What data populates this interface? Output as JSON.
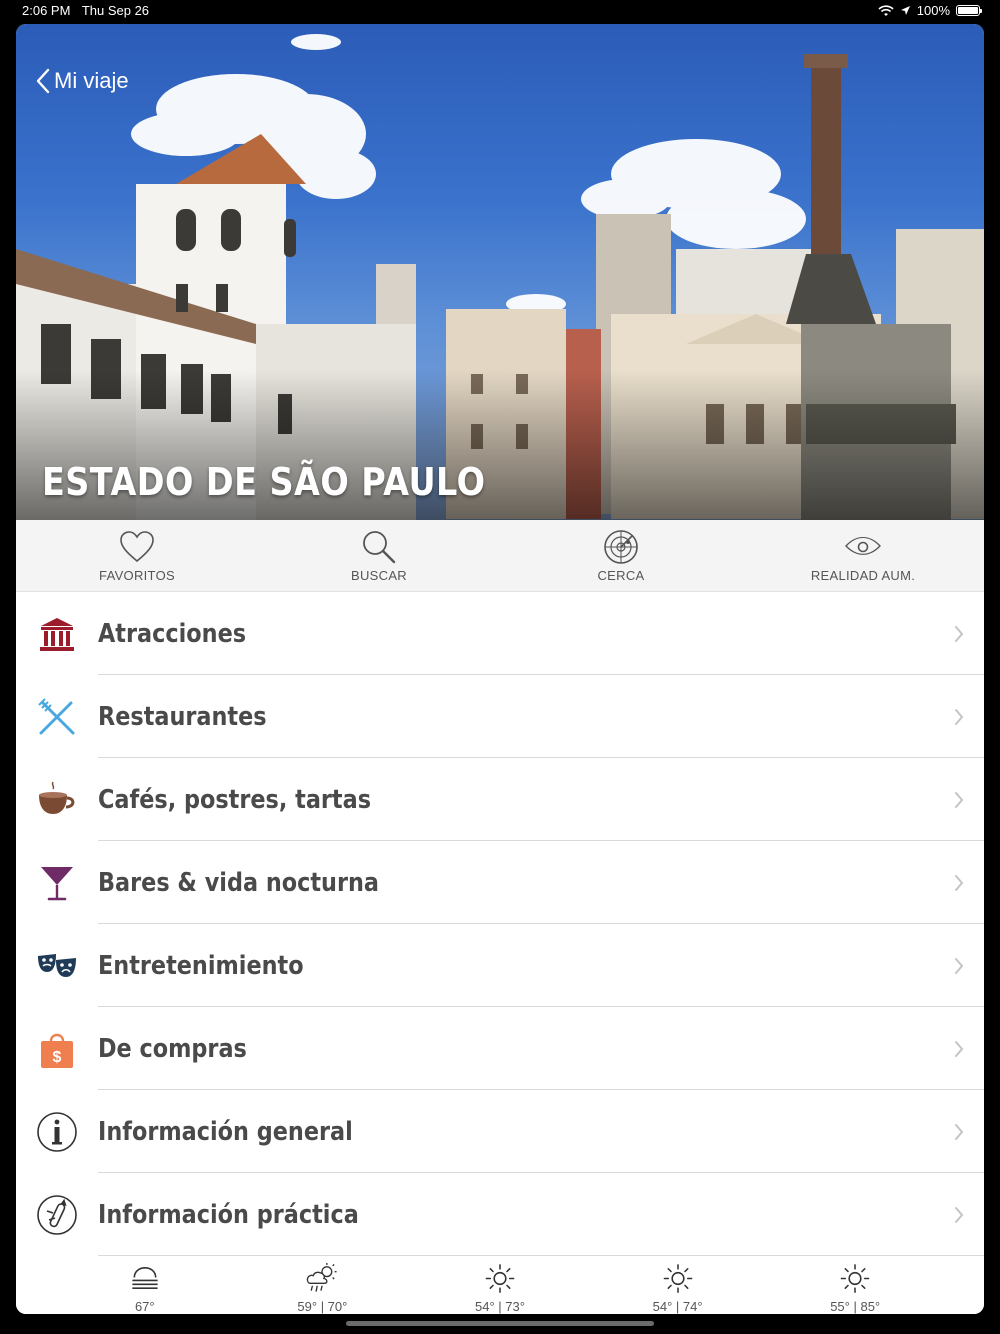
{
  "status_bar": {
    "time": "2:06 PM",
    "date": "Thu Sep 26",
    "battery": "100%",
    "battery_level": 1.0
  },
  "header": {
    "back_label": "Mi viaje",
    "title": "ESTADO DE SÃO PAULO"
  },
  "toolbar": [
    {
      "label": "FAVORITOS",
      "icon": "heart-icon"
    },
    {
      "label": "BUSCAR",
      "icon": "search-icon"
    },
    {
      "label": "CERCA",
      "icon": "radar-icon"
    },
    {
      "label": "REALIDAD AUM.",
      "icon": "eye-icon"
    }
  ],
  "menu": [
    {
      "label": "Atracciones",
      "icon": "museum-icon",
      "color": "#9b1c2a"
    },
    {
      "label": "Restaurantes",
      "icon": "fork-knife-icon",
      "color": "#4aa8e0"
    },
    {
      "label": "Cafés, postres, tartas",
      "icon": "coffee-cup-icon",
      "color": "#7b4a32"
    },
    {
      "label": "Bares & vida nocturna",
      "icon": "cocktail-icon",
      "color": "#6e2b66"
    },
    {
      "label": "Entretenimiento",
      "icon": "theater-masks-icon",
      "color": "#1f3b57"
    },
    {
      "label": "De compras",
      "icon": "shopping-bag-icon",
      "color": "#ef7f4f"
    },
    {
      "label": "Información general",
      "icon": "info-icon",
      "color": "#333333"
    },
    {
      "label": "Información práctica",
      "icon": "swiss-knife-icon",
      "color": "#333333"
    }
  ],
  "weather": [
    {
      "icon": "fog-icon",
      "temp": "67°"
    },
    {
      "icon": "sun-rain-icon",
      "temp": "59° | 70°"
    },
    {
      "icon": "sun-icon",
      "temp": "54° | 73°"
    },
    {
      "icon": "sun-icon",
      "temp": "54° | 74°"
    },
    {
      "icon": "sun-icon",
      "temp": "55° | 85°"
    }
  ]
}
